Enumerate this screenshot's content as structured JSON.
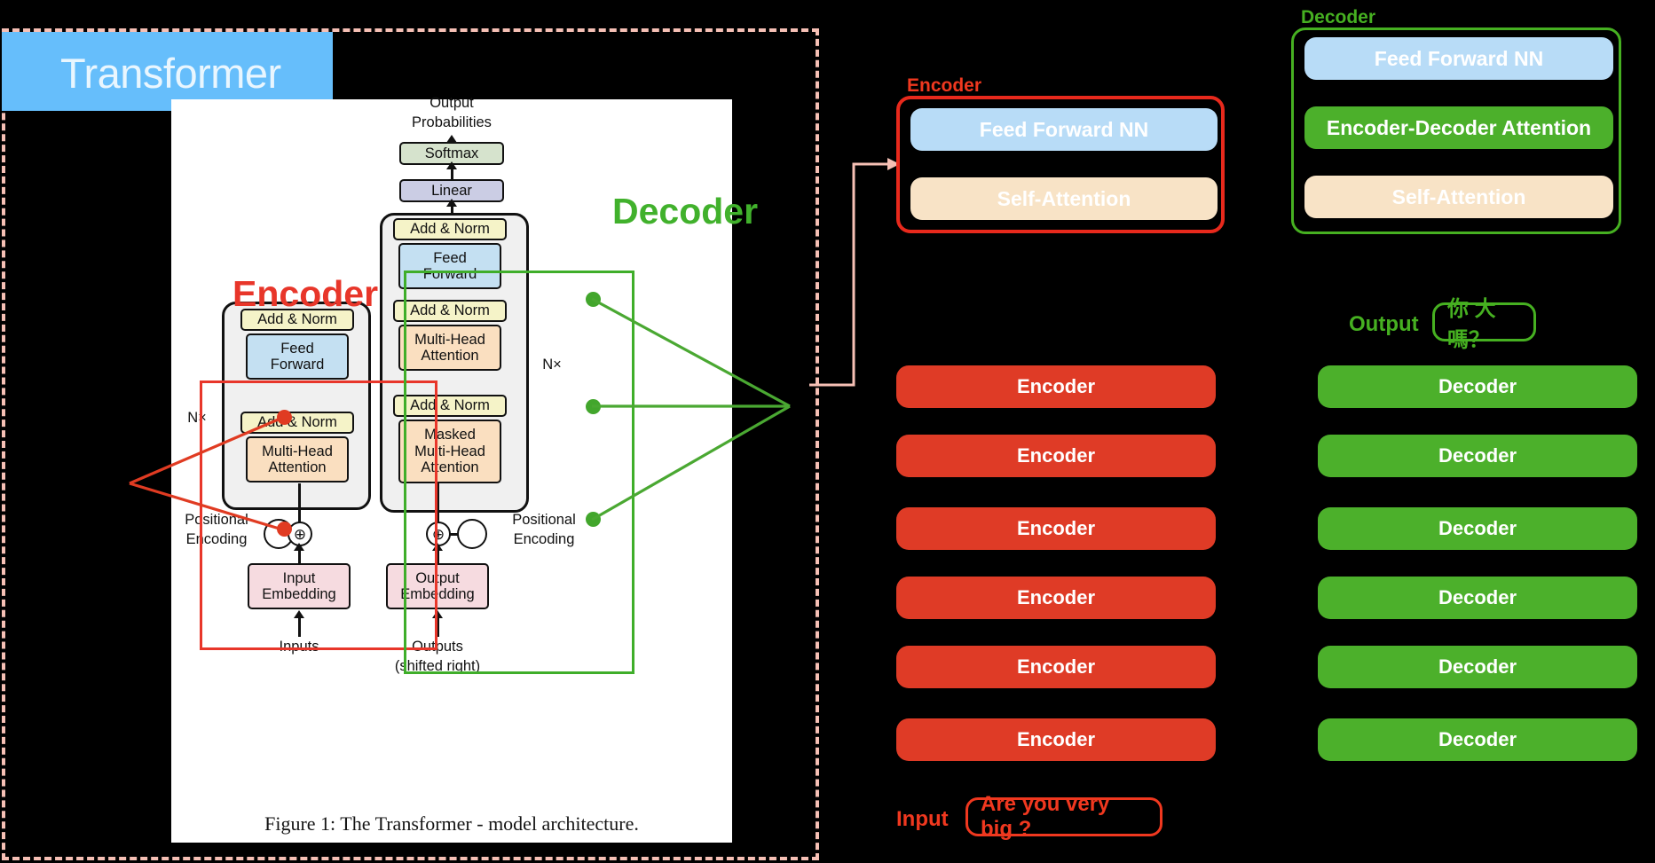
{
  "page": {
    "background": "#000000",
    "title": "Transformer",
    "title_highlight_color": "#66befb"
  },
  "figure": {
    "caption": "Figure 1: The Transformer - model architecture.",
    "encoder_label": "Encoder",
    "decoder_label": "Decoder",
    "encoder_label_color": "#e8362a",
    "decoder_label_color": "#41b12c",
    "nodes": {
      "output_probabilities": "Output\nProbabilities",
      "output_probabilities_line1": "Output",
      "output_probabilities_line2": "Probabilities",
      "softmax": "Softmax",
      "linear": "Linear",
      "add_norm": "Add & Norm",
      "feed_forward_l1": "Feed",
      "feed_forward_l2": "Forward",
      "multi_head_l1": "Multi-Head",
      "multi_head_l2": "Attention",
      "masked_l1": "Masked",
      "masked_l2": "Multi-Head",
      "masked_l3": "Attention",
      "input_embedding_l1": "Input",
      "input_embedding_l2": "Embedding",
      "output_embedding_l1": "Output",
      "output_embedding_l2": "Embedding",
      "positional_encoding_l1": "Positional",
      "positional_encoding_l2": "Encoding",
      "nx": "N×",
      "inputs": "Inputs",
      "outputs_l1": "Outputs",
      "outputs_l2": "(shifted right)",
      "plus": "⊕"
    }
  },
  "encoder_detail": {
    "label": "Encoder",
    "label_color": "#f0381f",
    "layers": [
      {
        "name": "Feed Forward NN",
        "color": "#b8dcf7"
      },
      {
        "name": "Self-Attention",
        "color": "#f8e3c6"
      }
    ]
  },
  "decoder_detail": {
    "label": "Decoder",
    "label_color": "#46b021",
    "layers": [
      {
        "name": "Feed Forward NN",
        "color": "#b8dcf7"
      },
      {
        "name": "Encoder-Decoder Attention",
        "color": "#4cb02b"
      },
      {
        "name": "Self-Attention",
        "color": "#f8e3c6"
      }
    ]
  },
  "encoder_stack": {
    "color": "#df3b26",
    "blocks": [
      "Encoder",
      "Encoder",
      "Encoder",
      "Encoder",
      "Encoder",
      "Encoder"
    ]
  },
  "decoder_stack": {
    "color": "#4cb02b",
    "blocks": [
      "Decoder",
      "Decoder",
      "Decoder",
      "Decoder",
      "Decoder",
      "Decoder"
    ]
  },
  "io": {
    "input_label": "Input",
    "input_value": "Are you very big ?",
    "input_color": "#f0381f",
    "output_label": "Output",
    "output_value": "你 大 嗎？",
    "output_color": "#46b021"
  }
}
